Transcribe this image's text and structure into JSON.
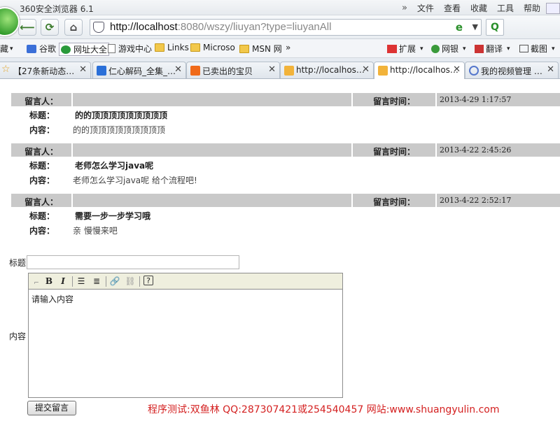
{
  "browser": {
    "title": "360安全浏览器 6.1",
    "menu": [
      "文件",
      "查看",
      "收藏",
      "工具",
      "帮助"
    ],
    "url_host": "http://localhost",
    "url_rest": ":8080/wszy/liuyan?type=liuyanAll"
  },
  "bookmarks": {
    "items": [
      "藏",
      "谷歌",
      "网址大全",
      "游戏中心",
      "Links",
      "Microso",
      "MSN 网"
    ],
    "more": "»",
    "right": [
      "扩展",
      "网银",
      "翻译",
      "截图"
    ]
  },
  "tabs": [
    {
      "label": "【27条新动态…",
      "icon": "star-icon"
    },
    {
      "label": "仁心解码_全集_…",
      "icon": "soku-icon"
    },
    {
      "label": "已卖出的宝贝",
      "icon": "taobao-icon"
    },
    {
      "label": "http://localhos…",
      "icon": "pma-icon"
    },
    {
      "label": "http://localhos…",
      "icon": "pma-icon",
      "active": true
    },
    {
      "label": "我的视频管理 …",
      "icon": "video-icon"
    }
  ],
  "messages": {
    "labels": {
      "author": "留言人：",
      "time": "留言时间：",
      "title": "标题：",
      "content": "内容："
    },
    "items": [
      {
        "author": "",
        "time": "2013-4-29 1:17:57",
        "title": "的的顶顶顶顶顶顶顶顶顶",
        "content": "的的顶顶顶顶顶顶顶顶顶"
      },
      {
        "author": "",
        "time": "2013-4-22 2:45:26",
        "title": "老师怎么学习java呢",
        "content": "老师怎么学习java呢  给个流程吧!"
      },
      {
        "author": "",
        "time": "2013-4-22 2:52:17",
        "title": "需要一步一步学习哦",
        "content": "亲  慢慢来吧"
      }
    ]
  },
  "form": {
    "title_label": "标题",
    "title_value": "",
    "content_label": "内容",
    "editor_text": "请输入内容",
    "submit_label": "提交留言"
  },
  "watermark": "程序测试:双鱼林 QQ:287307421或254540457 网站:www.shuangyulin.com",
  "colors": {
    "header_bg": "#c9c9c9",
    "watermark": "#d42020",
    "toolbar_bg": "#efefde"
  }
}
